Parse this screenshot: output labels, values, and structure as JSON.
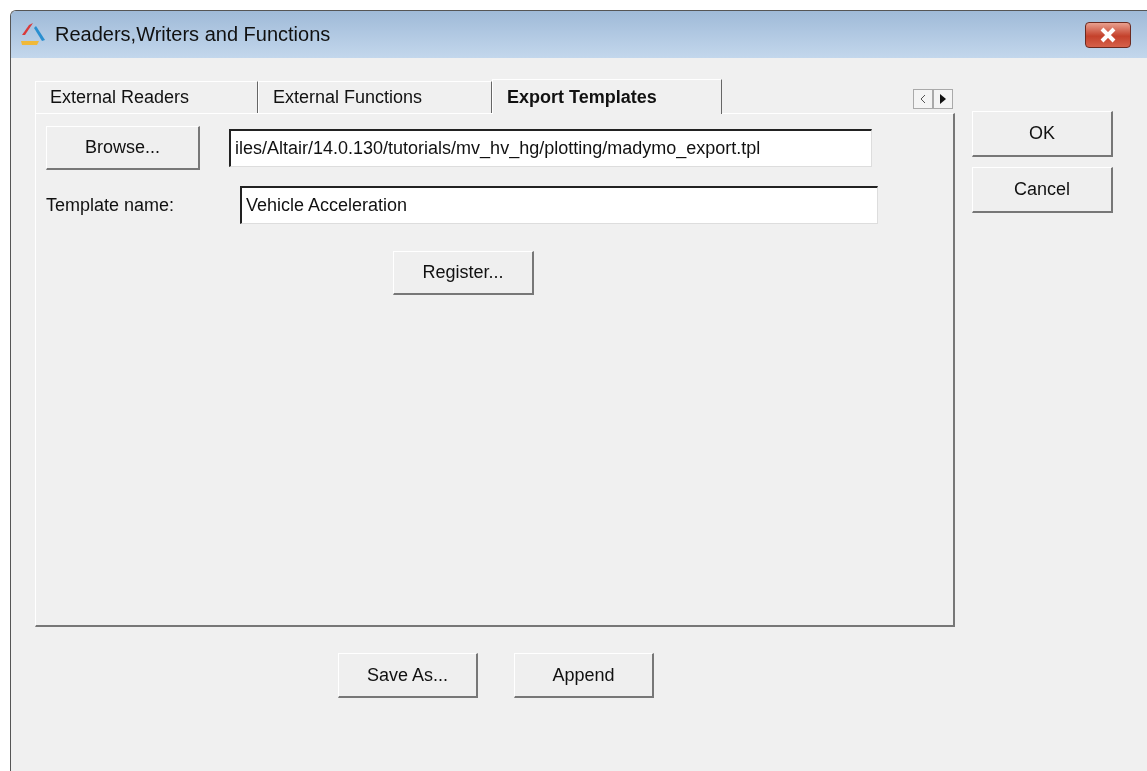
{
  "window": {
    "title": "Readers,Writers and Functions"
  },
  "tabs": [
    {
      "label": "External Readers",
      "selected": false
    },
    {
      "label": "External Functions",
      "selected": false
    },
    {
      "label": "Export Templates",
      "selected": true
    }
  ],
  "panel": {
    "browse_button": "Browse...",
    "file_path": "iles/Altair/14.0.130/tutorials/mv_hv_hg/plotting/madymo_export.tpl",
    "template_label": "Template name:",
    "template_name": "Vehicle Acceleration",
    "register_button": "Register..."
  },
  "side_buttons": [
    "OK",
    "Cancel"
  ],
  "bottom_buttons": [
    "Save As...",
    "Append"
  ]
}
